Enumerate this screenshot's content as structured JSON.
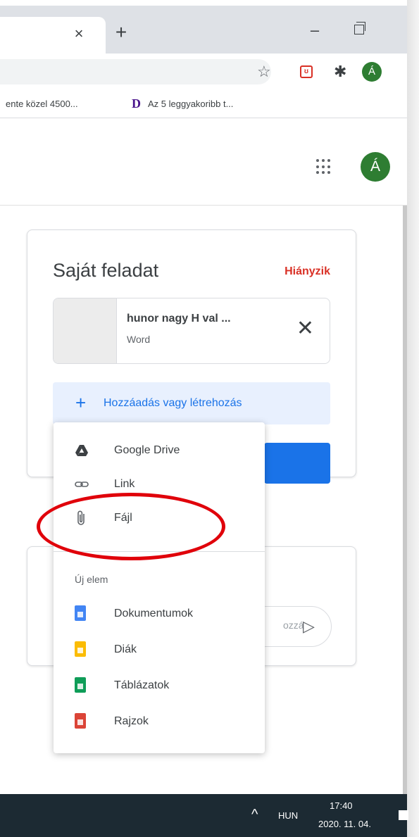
{
  "browser": {
    "tab_close": "×",
    "new_tab": "+",
    "minimize": "–",
    "bookmarks": [
      {
        "label": "ente közel 4500..."
      },
      {
        "icon_letter": "D",
        "label": "Az 5 leggyakoribb t..."
      }
    ],
    "profile_initial": "Á"
  },
  "app": {
    "profile_initial": "Á"
  },
  "assignment": {
    "title": "Saját feladat",
    "status": "Hiányzik",
    "attachment": {
      "name": "hunor nagy H val ...",
      "type": "Word"
    },
    "add_label": "Hozzáadás vagy létrehozás"
  },
  "comment": {
    "placeholder": "ozzá"
  },
  "menu": {
    "items": [
      {
        "label": "Google Drive",
        "icon": "google-drive-icon"
      },
      {
        "label": "Link",
        "icon": "link-icon"
      },
      {
        "label": "Fájl",
        "icon": "paperclip-icon"
      }
    ],
    "section_label": "Új elem",
    "new_items": [
      {
        "label": "Dokumentumok",
        "icon": "docs-icon",
        "color": "#4285f4"
      },
      {
        "label": "Diák",
        "icon": "slides-icon",
        "color": "#fbbc04"
      },
      {
        "label": "Táblázatok",
        "icon": "sheets-icon",
        "color": "#0f9d58"
      },
      {
        "label": "Rajzok",
        "icon": "drawings-icon",
        "color": "#db4437"
      }
    ]
  },
  "taskbar": {
    "language": "HUN",
    "time": "17:40",
    "date": "2020. 11. 04."
  },
  "colors": {
    "accent": "#1a73e8",
    "status_red": "#d93025",
    "highlight_circle": "#e0000a",
    "avatar_green": "#2e7d32"
  }
}
